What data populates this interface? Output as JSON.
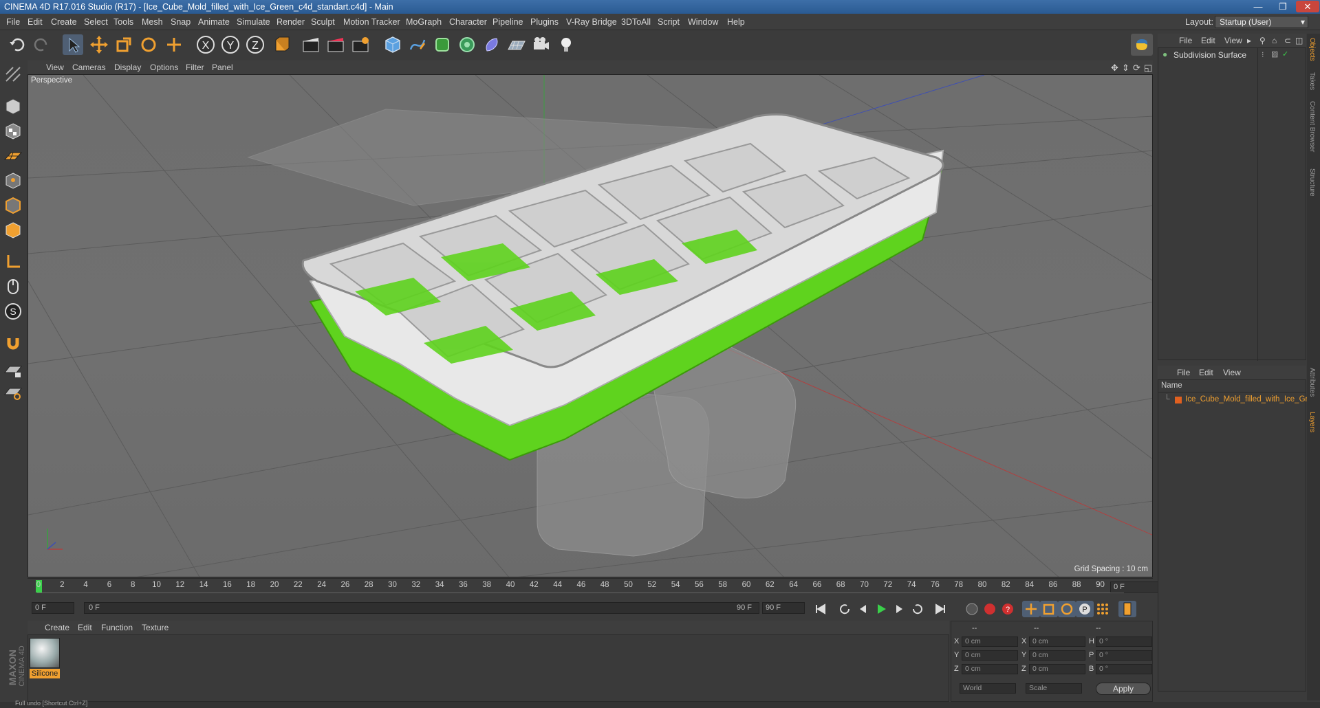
{
  "window": {
    "title": "CINEMA 4D R17.016 Studio (R17) - [Ice_Cube_Mold_filled_with_Ice_Green_c4d_standart.c4d] - Main"
  },
  "menu": [
    "File",
    "Edit",
    "Create",
    "Select",
    "Tools",
    "Mesh",
    "Snap",
    "Animate",
    "Simulate",
    "Render",
    "Sculpt",
    "Motion Tracker",
    "MoGraph",
    "Character",
    "Pipeline",
    "Plugins",
    "V-Ray Bridge",
    "3DToAll",
    "Script",
    "Window",
    "Help"
  ],
  "layout": {
    "label": "Layout:",
    "value": "Startup (User)"
  },
  "viewport": {
    "menu": [
      "View",
      "Cameras",
      "Display",
      "Options",
      "Filter",
      "Panel"
    ],
    "label": "Perspective",
    "grid_spacing": "Grid Spacing : 10 cm"
  },
  "timeline": {
    "ticks": [
      "0",
      "2",
      "4",
      "6",
      "8",
      "10",
      "12",
      "14",
      "16",
      "18",
      "20",
      "22",
      "24",
      "26",
      "28",
      "30",
      "32",
      "34",
      "36",
      "38",
      "40",
      "42",
      "44",
      "46",
      "48",
      "50",
      "52",
      "54",
      "56",
      "58",
      "60",
      "62",
      "64",
      "66",
      "68",
      "70",
      "72",
      "74",
      "76",
      "78",
      "80",
      "82",
      "84",
      "86",
      "88",
      "90"
    ],
    "current": "0 F",
    "start": "0 F",
    "range_start": "0 F",
    "range_end": "90 F",
    "end": "90 F"
  },
  "material_manager": {
    "menu": [
      "Create",
      "Edit",
      "Function",
      "Texture"
    ],
    "materials": [
      {
        "name": "Silicone"
      }
    ]
  },
  "coordinates": {
    "header": [
      "--",
      "--",
      "--"
    ],
    "rows": [
      {
        "l1": "X",
        "v1": "0 cm",
        "l2": "X",
        "v2": "0 cm",
        "l3": "H",
        "v3": "0 °"
      },
      {
        "l1": "Y",
        "v1": "0 cm",
        "l2": "Y",
        "v2": "0 cm",
        "l3": "P",
        "v3": "0 °"
      },
      {
        "l1": "Z",
        "v1": "0 cm",
        "l2": "Z",
        "v2": "0 cm",
        "l3": "B",
        "v3": "0 °"
      }
    ],
    "mode1": "World",
    "mode2": "Scale",
    "apply": "Apply"
  },
  "objects_panel": {
    "menu": [
      "File",
      "Edit",
      "View"
    ],
    "items": [
      {
        "name": "Subdivision Surface"
      }
    ]
  },
  "layers_panel": {
    "menu": [
      "File",
      "Edit",
      "View"
    ],
    "column": "Name",
    "items": [
      {
        "name": "Ice_Cube_Mold_filled_with_Ice_Gr"
      }
    ]
  },
  "side_tabs": [
    "Objects",
    "Takes",
    "Content Browser",
    "Structure",
    "Attributes",
    "Layers"
  ],
  "status": {
    "text": "Full undo [Shortcut Ctrl+Z]"
  },
  "brand": {
    "line1": "MAXON",
    "line2": "CINEMA 4D"
  },
  "colors": {
    "accent_orange": "#f0a030",
    "green": "#5fd31e",
    "title_blue": "#2a5a92"
  }
}
